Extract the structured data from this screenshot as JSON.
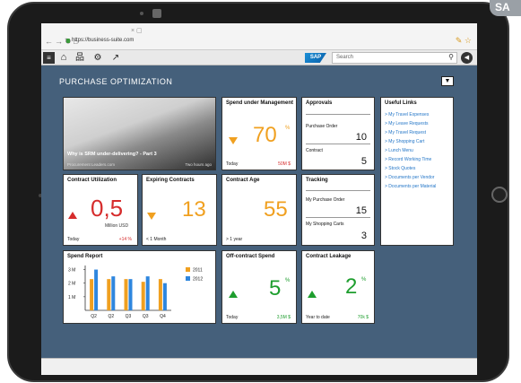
{
  "corner_badge": "SA",
  "browser": {
    "url": "https://business-suite.com"
  },
  "app_bar": {
    "logo": "SAP",
    "search_placeholder": "Search",
    "icons": [
      "menu-icon",
      "home-icon",
      "org-chart-icon",
      "gear-icon",
      "share-icon",
      "search-icon",
      "back-icon"
    ]
  },
  "page": {
    "title": "PURCHASE OPTIMIZATION"
  },
  "tiles": {
    "news": {
      "headline": "Why is SRM under-delivering? - Part 3",
      "source": "Procurement Leaders.com",
      "time": "Two hours ago"
    },
    "spend": {
      "title": "Spend under Management",
      "value": "70",
      "unit": "%",
      "footer_left": "Today",
      "footer_right": "50M $"
    },
    "approvals": {
      "title": "Approvals",
      "rows": [
        {
          "label": "Purchase Order",
          "value": "10"
        },
        {
          "label": "Contract",
          "value": "5"
        }
      ]
    },
    "links": {
      "title": "Useful Links",
      "items": [
        "> My Travel Expenses",
        "> My Leave Requests",
        "> My Travel Request",
        "> My Shopping Cart",
        "> Lunch Menu",
        "> Record Working Time",
        "> Stock Quotes",
        "> Documents per Vendor",
        "> Documents per Material"
      ]
    },
    "utilization": {
      "title": "Contract Utilization",
      "value": "0,5",
      "unit": "Million USD",
      "footer_left": "Today",
      "footer_right": "+14 %"
    },
    "expiring": {
      "title": "Expiring Contracts",
      "value": "13",
      "footer_left": "< 1 Month"
    },
    "age": {
      "title": "Contract Age",
      "value": "55",
      "footer_left": "> 1 year"
    },
    "tracking": {
      "title": "Tracking",
      "rows": [
        {
          "label": "My Purchase Order",
          "value": "15"
        },
        {
          "label": "My Shopping Carts",
          "value": "3"
        }
      ]
    },
    "spend_report": {
      "title": "Spend Report"
    },
    "offcontract": {
      "title": "Off-contract Spend",
      "value": "5",
      "unit": "%",
      "footer_left": "Today",
      "footer_right": "3,5M $"
    },
    "leakage": {
      "title": "Contract Leakage",
      "value": "2",
      "unit": "%",
      "footer_left": "Year to date",
      "footer_right": "70k $"
    }
  },
  "colors": {
    "orange": "#f0a020",
    "red": "#d62c2c",
    "green": "#1e9e2e",
    "blue": "#2e86de",
    "link": "#2577c8",
    "background": "#45607b"
  },
  "chart_data": {
    "type": "bar",
    "title": "Spend Report",
    "categories": [
      "Q2",
      "Q2",
      "Q3",
      "Q3",
      "Q4"
    ],
    "series": [
      {
        "name": "2011",
        "values": [
          2.3,
          2.3,
          2.3,
          2.1,
          2.3
        ]
      },
      {
        "name": "2012",
        "values": [
          3.0,
          2.5,
          2.3,
          2.5,
          2.0
        ]
      }
    ],
    "y_ticks": [
      "3 M",
      "2 M",
      "1 M"
    ],
    "ylim": [
      0,
      3.3
    ],
    "legend": "right"
  }
}
